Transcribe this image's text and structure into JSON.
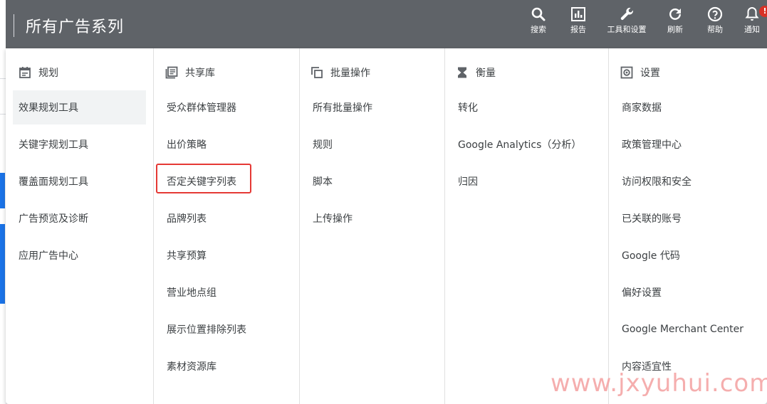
{
  "header": {
    "title": "所有广告系列",
    "actions": [
      {
        "label": "搜索",
        "icon": "search-icon"
      },
      {
        "label": "报告",
        "icon": "report-icon"
      },
      {
        "label": "工具和设置",
        "icon": "wrench-icon"
      },
      {
        "label": "刷新",
        "icon": "refresh-icon"
      },
      {
        "label": "帮助",
        "icon": "help-icon"
      },
      {
        "label": "通知",
        "icon": "bell-icon",
        "badge": "!"
      }
    ]
  },
  "columns": [
    {
      "heading": "规划",
      "icon": "calendar-icon",
      "items": [
        "效果规划工具",
        "关键字规划工具",
        "覆盖面规划工具",
        "广告预览及诊断",
        "应用广告中心"
      ],
      "selected_index": 0
    },
    {
      "heading": "共享库",
      "icon": "library-icon",
      "items": [
        "受众群体管理器",
        "出价策略",
        "否定关键字列表",
        "品牌列表",
        "共享预算",
        "营业地点组",
        "展示位置排除列表",
        "素材资源库"
      ],
      "highlighted_index": 2
    },
    {
      "heading": "批量操作",
      "icon": "copy-icon",
      "items": [
        "所有批量操作",
        "规则",
        "脚本",
        "上传操作"
      ]
    },
    {
      "heading": "衡量",
      "icon": "hourglass-icon",
      "items": [
        "转化",
        "Google Analytics（分析）",
        "归因"
      ]
    },
    {
      "heading": "设置",
      "icon": "settings-icon",
      "items": [
        "商家数据",
        "政策管理中心",
        "访问权限和安全",
        "已关联的账号",
        "Google 代码",
        "偏好设置",
        "Google Merchant Center",
        "内容适宜性"
      ]
    }
  ],
  "watermark": "www.jxyuhui.com",
  "colors": {
    "topbar": "#5f6368",
    "highlight_border": "#e53935",
    "badge": "#d93025",
    "accent_blue": "#1a73e8"
  }
}
